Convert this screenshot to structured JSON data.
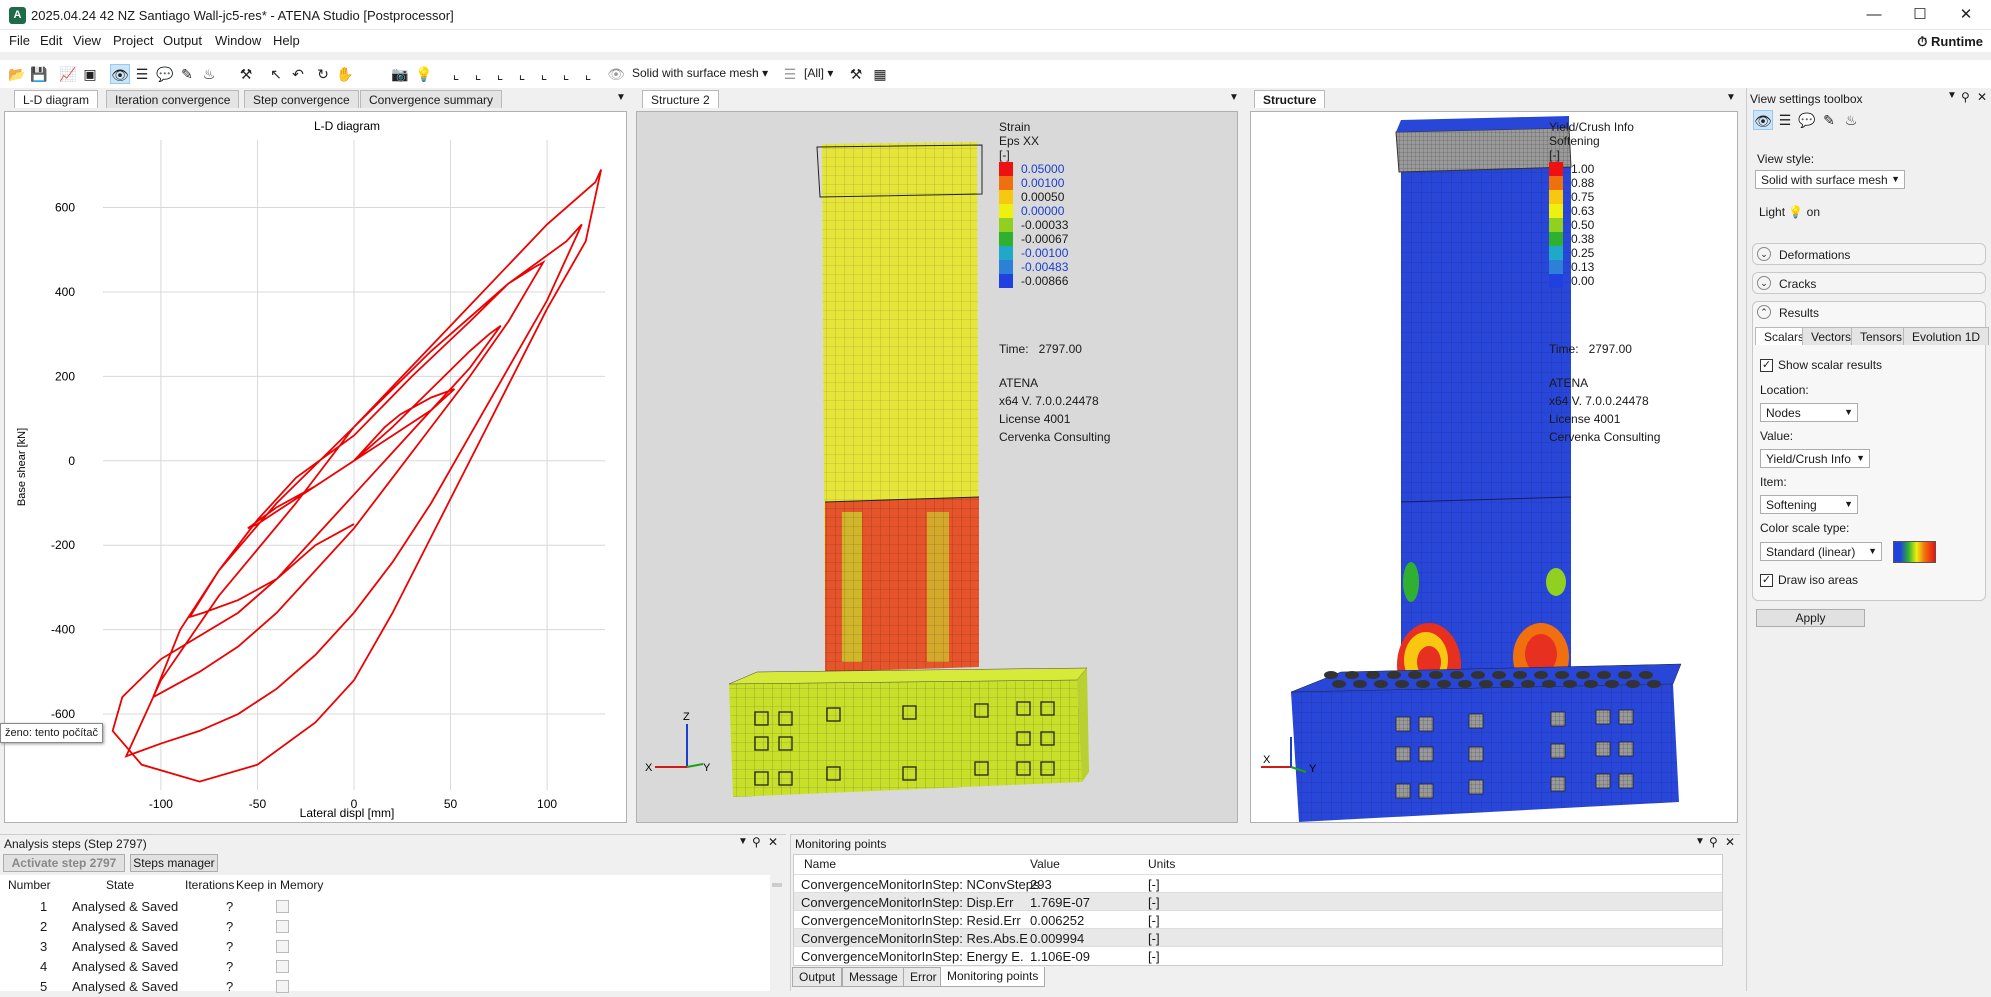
{
  "window": {
    "title": "2025.04.24 42 NZ Santiago Wall-jc5-res* - ATENA Studio [Postprocessor]",
    "logo": "A",
    "min_icon": "minimize-icon",
    "max_icon": "maximize-icon",
    "close_icon": "close-icon"
  },
  "menu": {
    "items": [
      "File",
      "Edit",
      "View",
      "Project",
      "Output",
      "Window",
      "Help"
    ],
    "runtime": "Runtime"
  },
  "toolbar": {
    "view_style": "Solid with surface mesh",
    "layers": "[All]"
  },
  "left_panel": {
    "tabs": [
      "L-D diagram",
      "Iteration convergence",
      "Step convergence",
      "Convergence summary"
    ],
    "tooltip": "ženo: tento počítač"
  },
  "chart_data": {
    "type": "line",
    "title": "L-D diagram",
    "xlabel": "Lateral displ [mm]",
    "ylabel": "Base shear [kN]",
    "xlim": [
      -130,
      130
    ],
    "ylim": [
      -780,
      760
    ],
    "x_ticks": [
      -100,
      -50,
      0,
      50,
      100
    ],
    "y_ticks": [
      600,
      400,
      200,
      0,
      -200,
      -400,
      -600
    ],
    "grid": true,
    "series": [
      {
        "color": "#ee0000",
        "x": [
          0,
          8,
          16,
          24,
          32,
          40,
          46,
          52,
          40,
          20,
          0,
          -20,
          -40,
          -50,
          -55,
          -40,
          -20,
          0,
          20,
          40,
          60,
          70,
          76,
          60,
          40,
          20,
          0,
          -20,
          -40,
          -60,
          -78,
          -85,
          -70,
          -50,
          -30,
          0,
          30,
          60,
          80,
          94,
          98,
          80,
          60,
          40,
          20,
          0,
          -20,
          -40,
          -60,
          -80,
          -96,
          -104,
          -90,
          -70,
          -40,
          0,
          40,
          80,
          110,
          118,
          100,
          80,
          60,
          40,
          20,
          0,
          -20,
          -40,
          -60,
          -80,
          -100,
          -112,
          -118,
          -100,
          -70,
          -30,
          0,
          50,
          100,
          125,
          128,
          120,
          100,
          80,
          60,
          40,
          20,
          0,
          -20,
          -50,
          -80,
          -110,
          -125,
          -120,
          -100,
          -60,
          -20,
          0
        ],
        "y": [
          0,
          40,
          80,
          110,
          130,
          150,
          160,
          170,
          120,
          60,
          0,
          -60,
          -120,
          -150,
          -160,
          -110,
          -60,
          0,
          80,
          170,
          260,
          300,
          320,
          220,
          120,
          20,
          -80,
          -180,
          -280,
          -330,
          -360,
          -370,
          -260,
          -140,
          -40,
          60,
          200,
          330,
          420,
          460,
          470,
          330,
          200,
          80,
          -40,
          -160,
          -260,
          -360,
          -440,
          -500,
          -540,
          -560,
          -400,
          -260,
          -100,
          80,
          260,
          420,
          520,
          560,
          380,
          220,
          60,
          -100,
          -240,
          -360,
          -460,
          -540,
          -600,
          -640,
          -670,
          -690,
          -700,
          -520,
          -320,
          -100,
          80,
          320,
          560,
          660,
          690,
          520,
          360,
          180,
          0,
          -180,
          -360,
          -520,
          -620,
          -720,
          -760,
          -720,
          -640,
          -560,
          -470,
          -360,
          -200,
          -150
        ]
      }
    ]
  },
  "struct2": {
    "tab": "Structure 2",
    "legend_title": "Strain",
    "legend_sub": "Eps XX",
    "legend_unit": "[-]",
    "legend": [
      {
        "color": "#ee1111",
        "label": "0.05000"
      },
      {
        "color": "#f07010",
        "label": "0.00100"
      },
      {
        "color": "#f8c810",
        "label": "0.00050"
      },
      {
        "color": "#eef010",
        "label": "0.00000"
      },
      {
        "color": "#90d020",
        "label": "-0.00033"
      },
      {
        "color": "#30b030",
        "label": "-0.00067"
      },
      {
        "color": "#20a8c8",
        "label": "-0.00100"
      },
      {
        "color": "#2c80d8",
        "label": "-0.00483"
      },
      {
        "color": "#2040e0",
        "label": "-0.00866"
      }
    ],
    "time_label": "Time:",
    "time_value": "2797.00",
    "info": [
      "ATENA",
      "x64 V. 7.0.0.24478",
      "License 4001",
      "Cervenka Consulting"
    ],
    "axis": [
      "X",
      "Y",
      "Z"
    ]
  },
  "struct1": {
    "tab": "Structure",
    "legend_title": "Yield/Crush Info",
    "legend_sub": "Softening",
    "legend_unit": "[-]",
    "legend": [
      {
        "color": "#ee1111",
        "label": "1.00"
      },
      {
        "color": "#f07010",
        "label": "0.88"
      },
      {
        "color": "#f8c810",
        "label": "0.75"
      },
      {
        "color": "#eef010",
        "label": "0.63"
      },
      {
        "color": "#90d020",
        "label": "0.50"
      },
      {
        "color": "#30b030",
        "label": "0.38"
      },
      {
        "color": "#20a8c8",
        "label": "0.25"
      },
      {
        "color": "#2c80d8",
        "label": "0.13"
      },
      {
        "color": "#2040e0",
        "label": "0.00"
      }
    ],
    "time_label": "Time:",
    "time_value": "2797.00",
    "info": [
      "ATENA",
      "x64 V. 7.0.0.24478",
      "License 4001",
      "Cervenka Consulting"
    ],
    "axis": [
      "X",
      "Y"
    ]
  },
  "toolbox": {
    "title": "View settings toolbox",
    "view_style_label": "View style:",
    "view_style_value": "Solid with surface mesh",
    "light_label": "Light",
    "light_value": "on",
    "sections": [
      "Deformations",
      "Cracks",
      "Results"
    ],
    "tabs": [
      "Scalars",
      "Vectors",
      "Tensors",
      "Evolution 1D"
    ],
    "show_scalar": "Show scalar results",
    "location_label": "Location:",
    "location_value": "Nodes",
    "value_label": "Value:",
    "value_value": "Yield/Crush Info",
    "item_label": "Item:",
    "item_value": "Softening",
    "color_scale_label": "Color scale type:",
    "color_scale_value": "Standard (linear)",
    "draw_iso": "Draw iso areas",
    "apply": "Apply"
  },
  "analysis": {
    "title": "Analysis steps (Step 2797)",
    "activate": "Activate step 2797",
    "manager": "Steps manager",
    "columns": [
      "Number",
      "State",
      "Iterations",
      "Keep in Memory"
    ],
    "rows": [
      {
        "n": "1",
        "state": "Analysed & Saved",
        "it": "?"
      },
      {
        "n": "2",
        "state": "Analysed & Saved",
        "it": "?"
      },
      {
        "n": "3",
        "state": "Analysed & Saved",
        "it": "?"
      },
      {
        "n": "4",
        "state": "Analysed & Saved",
        "it": "?"
      },
      {
        "n": "5",
        "state": "Analysed & Saved",
        "it": "?"
      }
    ]
  },
  "monitoring": {
    "title": "Monitoring points",
    "columns": [
      "Name",
      "Value",
      "Units"
    ],
    "rows": [
      {
        "name": "ConvergenceMonitorInStep: NConvSteps",
        "value": "293",
        "units": "[-]"
      },
      {
        "name": "ConvergenceMonitorInStep: Disp.Err",
        "value": "1.769E-07",
        "units": "[-]"
      },
      {
        "name": "ConvergenceMonitorInStep: Resid.Err",
        "value": "0.006252",
        "units": "[-]"
      },
      {
        "name": "ConvergenceMonitorInStep: Res.Abs.E",
        "value": "0.009994",
        "units": "[-]"
      },
      {
        "name": "ConvergenceMonitorInStep: Energy E.",
        "value": "1.106E-09",
        "units": "[-]"
      }
    ],
    "bottom_tabs": [
      "Output",
      "Message",
      "Error",
      "Monitoring points"
    ]
  }
}
